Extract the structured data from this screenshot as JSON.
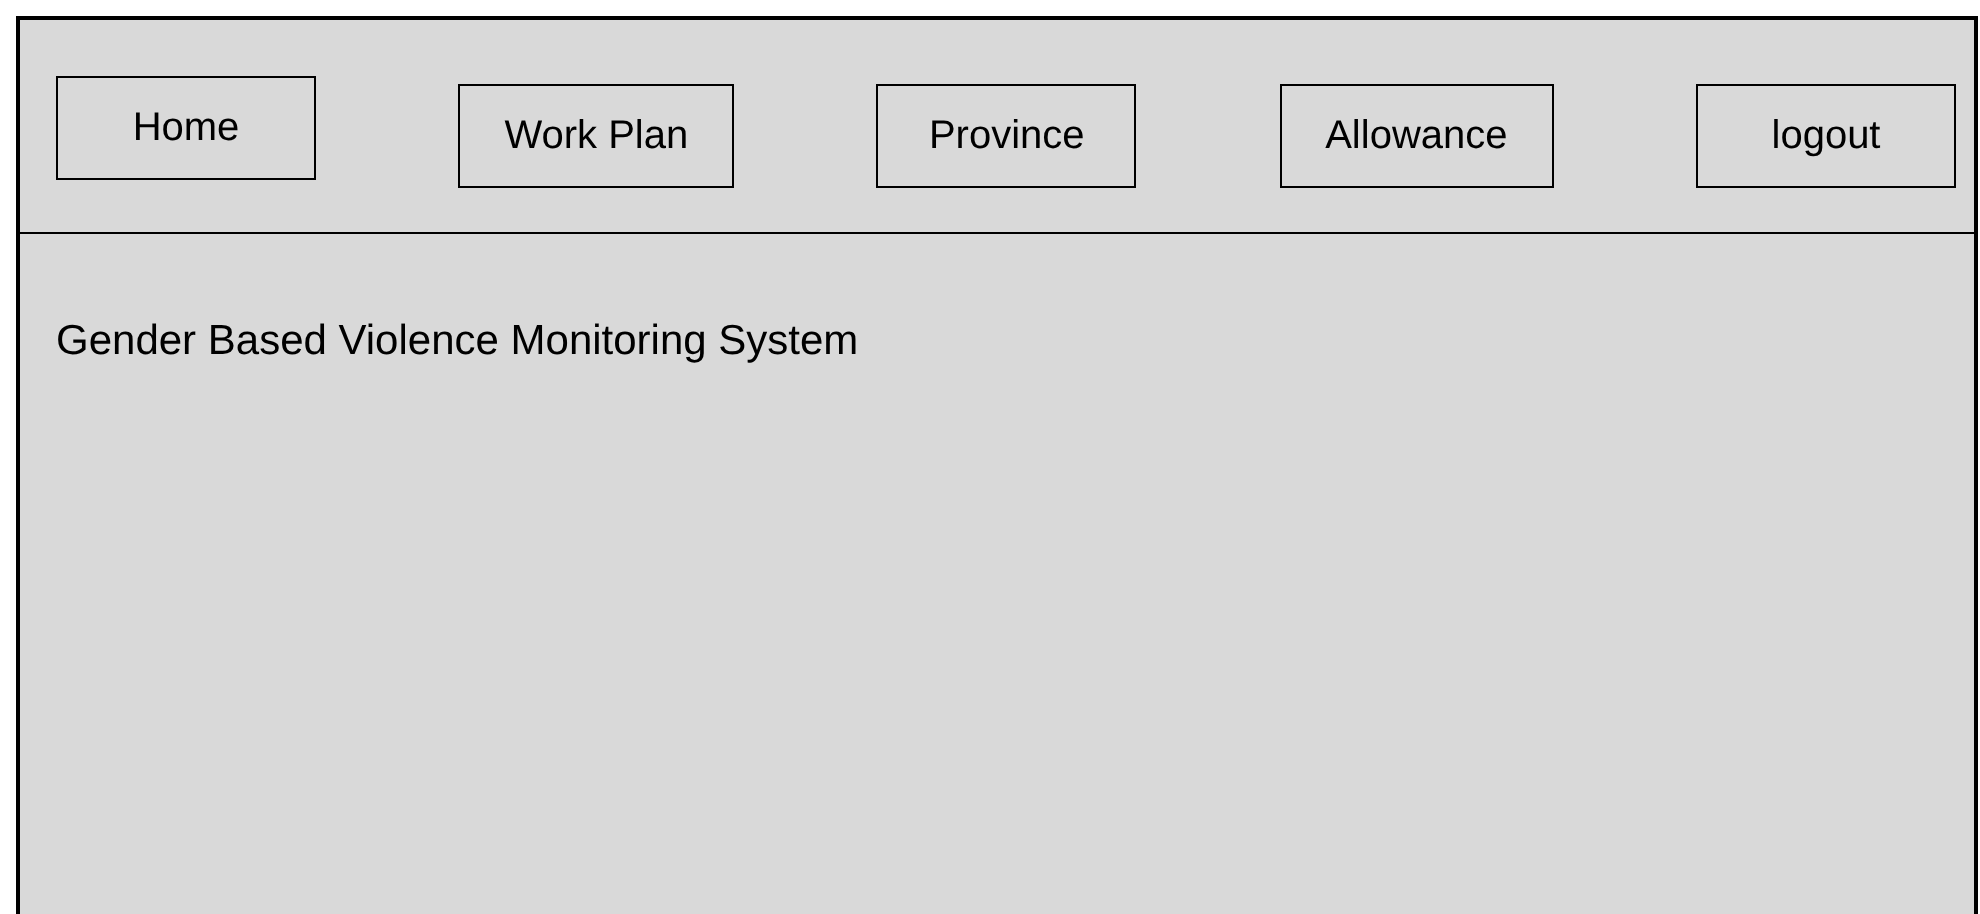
{
  "nav": {
    "buttons": [
      {
        "label": "Home"
      },
      {
        "label": "Work Plan"
      },
      {
        "label": "Province"
      },
      {
        "label": "Allowance"
      },
      {
        "label": "logout"
      }
    ]
  },
  "content": {
    "title": "Gender Based Violence Monitoring System"
  }
}
